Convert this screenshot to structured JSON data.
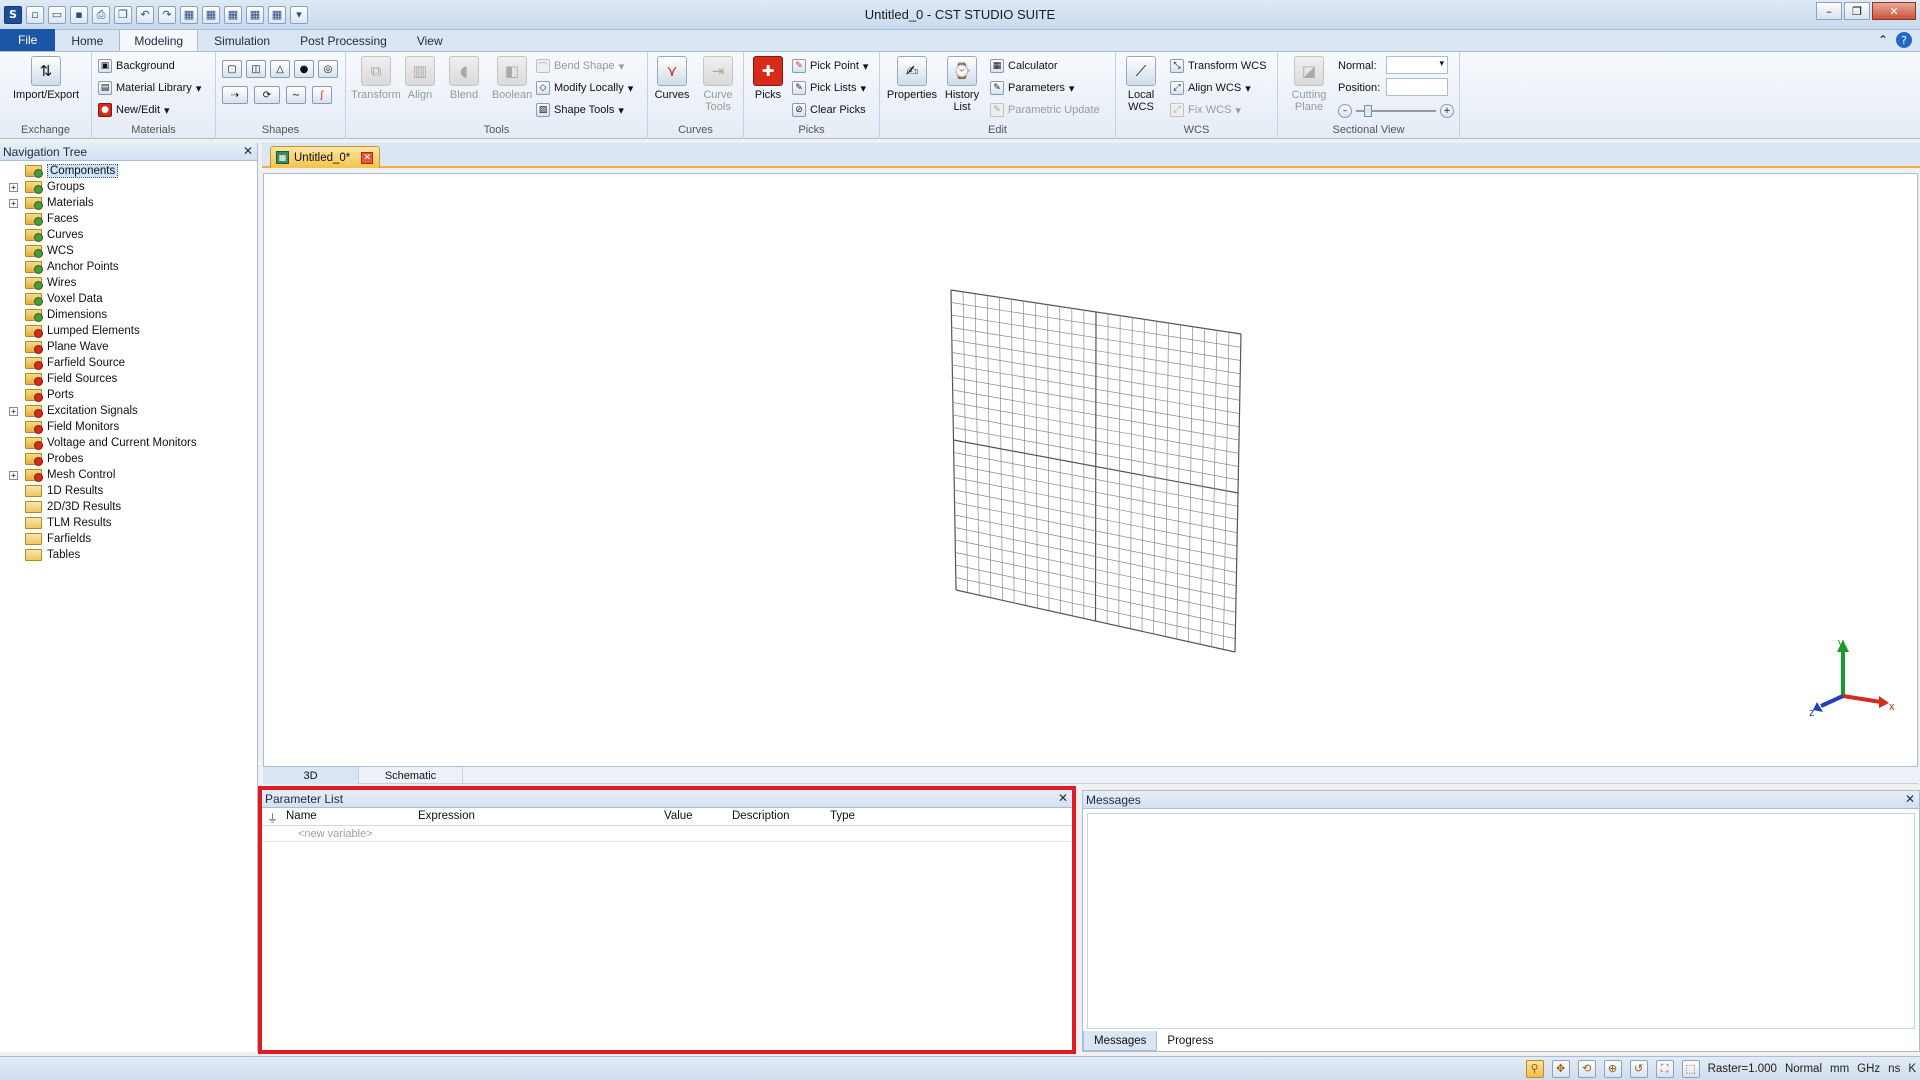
{
  "window": {
    "title": "Untitled_0 - CST STUDIO SUITE"
  },
  "qat": {
    "icons": [
      "app-icon",
      "new-icon",
      "open-icon",
      "save-icon",
      "print-icon",
      "copy-icon",
      "undo-icon",
      "redo-icon",
      "macro-icon",
      "macro-icon-2",
      "macro-icon-3",
      "macro-icon-4",
      "macro-icon-5",
      "customize-icon"
    ]
  },
  "ribbon_tabs": [
    {
      "label": "File"
    },
    {
      "label": "Home"
    },
    {
      "label": "Modeling"
    },
    {
      "label": "Simulation"
    },
    {
      "label": "Post Processing"
    },
    {
      "label": "View"
    }
  ],
  "ribbon": {
    "exchange": {
      "import_export": "Import/Export",
      "label": "Exchange"
    },
    "materials": {
      "background": "Background",
      "material_library": "Material Library",
      "new_edit": "New/Edit",
      "label": "Materials"
    },
    "shapes": {
      "label": "Shapes"
    },
    "tools": {
      "transform": "Transform",
      "align": "Align",
      "blend": "Blend",
      "boolean": "Boolean",
      "bend_shape": "Bend Shape",
      "modify_locally": "Modify Locally",
      "shape_tools": "Shape Tools",
      "label": "Tools"
    },
    "curves": {
      "curves": "Curves",
      "curve_tools": "Curve Tools",
      "label": "Curves"
    },
    "picks": {
      "picks": "Picks",
      "pick_point": "Pick Point",
      "pick_lists": "Pick Lists",
      "clear_picks": "Clear Picks",
      "label": "Picks"
    },
    "edit": {
      "properties": "Properties",
      "history_list": "History List",
      "calculator": "Calculator",
      "parameters": "Parameters",
      "parametric_update": "Parametric Update",
      "label": "Edit"
    },
    "wcs": {
      "local_wcs": "Local WCS",
      "transform_wcs": "Transform WCS",
      "align_wcs": "Align WCS",
      "fix_wcs": "Fix WCS",
      "label": "WCS"
    },
    "sectional": {
      "cutting_plane": "Cutting Plane",
      "normal_label": "Normal:",
      "position_label": "Position:",
      "label": "Sectional View"
    }
  },
  "nav_tree": {
    "title": "Navigation Tree",
    "items": [
      {
        "label": "Components",
        "expandable": false,
        "badge": "green",
        "selected": true
      },
      {
        "label": "Groups",
        "expandable": true,
        "badge": "green"
      },
      {
        "label": "Materials",
        "expandable": true,
        "badge": "green"
      },
      {
        "label": "Faces",
        "expandable": false,
        "badge": "green"
      },
      {
        "label": "Curves",
        "expandable": false,
        "badge": "green"
      },
      {
        "label": "WCS",
        "expandable": false,
        "badge": "green"
      },
      {
        "label": "Anchor Points",
        "expandable": false,
        "badge": "green"
      },
      {
        "label": "Wires",
        "expandable": false,
        "badge": "green"
      },
      {
        "label": "Voxel Data",
        "expandable": false,
        "badge": "green"
      },
      {
        "label": "Dimensions",
        "expandable": false,
        "badge": "green"
      },
      {
        "label": "Lumped Elements",
        "expandable": false,
        "badge": "red"
      },
      {
        "label": "Plane Wave",
        "expandable": false,
        "badge": "red"
      },
      {
        "label": "Farfield Source",
        "expandable": false,
        "badge": "red"
      },
      {
        "label": "Field Sources",
        "expandable": false,
        "badge": "red"
      },
      {
        "label": "Ports",
        "expandable": false,
        "badge": "red"
      },
      {
        "label": "Excitation Signals",
        "expandable": true,
        "badge": "red"
      },
      {
        "label": "Field Monitors",
        "expandable": false,
        "badge": "red"
      },
      {
        "label": "Voltage and Current Monitors",
        "expandable": false,
        "badge": "red"
      },
      {
        "label": "Probes",
        "expandable": false,
        "badge": "red"
      },
      {
        "label": "Mesh Control",
        "expandable": true,
        "badge": "red"
      },
      {
        "label": "1D Results",
        "expandable": false,
        "badge": "open"
      },
      {
        "label": "2D/3D Results",
        "expandable": false,
        "badge": "open"
      },
      {
        "label": "TLM Results",
        "expandable": false,
        "badge": "open"
      },
      {
        "label": "Farfields",
        "expandable": false,
        "badge": "open"
      },
      {
        "label": "Tables",
        "expandable": false,
        "badge": "open"
      }
    ]
  },
  "doc_tab": {
    "label": "Untitled_0*"
  },
  "view_tabs": [
    {
      "label": "3D"
    },
    {
      "label": "Schematic"
    }
  ],
  "axis": {
    "x": "x",
    "y": "y",
    "z": "z"
  },
  "param_list": {
    "title": "Parameter List",
    "columns": [
      "Name",
      "Expression",
      "Value",
      "Description",
      "Type"
    ],
    "new_variable": "<new variable>"
  },
  "messages": {
    "title": "Messages",
    "tabs": [
      "Messages",
      "Progress"
    ]
  },
  "status": {
    "raster": "Raster=1.000",
    "mode": "Normal",
    "units": [
      "mm",
      "GHz",
      "ns",
      "K"
    ]
  },
  "colors": {
    "accent": "#1d56a6",
    "highlight": "#e01b24",
    "tab_orange": "#f6c24d"
  }
}
